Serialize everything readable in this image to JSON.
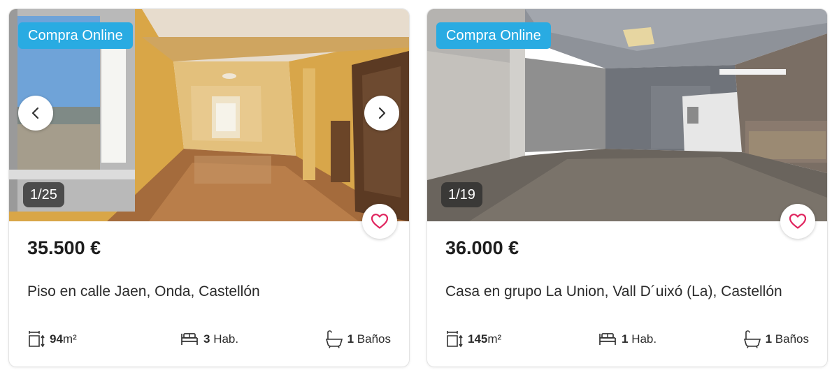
{
  "listings": [
    {
      "badge": "Compra Online",
      "photo_counter": "1/25",
      "price": "35.500 €",
      "title": "Piso en calle Jaen, Onda, Castellón",
      "area_value": "94",
      "area_unit": "m²",
      "rooms_value": "3",
      "rooms_unit": "Hab.",
      "baths_value": "1",
      "baths_unit": "Baños"
    },
    {
      "badge": "Compra Online",
      "photo_counter": "1/19",
      "price": "36.000 €",
      "title": "Casa en grupo La Union, Vall D´uixó (La), Castellón",
      "area_value": "145",
      "area_unit": "m²",
      "rooms_value": "1",
      "rooms_unit": "Hab.",
      "baths_value": "1",
      "baths_unit": "Baños"
    }
  ],
  "icons": {
    "prev": "chevron-left-icon",
    "next": "chevron-right-icon",
    "favorite": "heart-outline-icon",
    "area": "area-icon",
    "rooms": "bed-icon",
    "baths": "bathtub-icon"
  },
  "colors": {
    "badge": "#29abe2",
    "heart": "#e0245e",
    "text": "#1d1d1d"
  }
}
